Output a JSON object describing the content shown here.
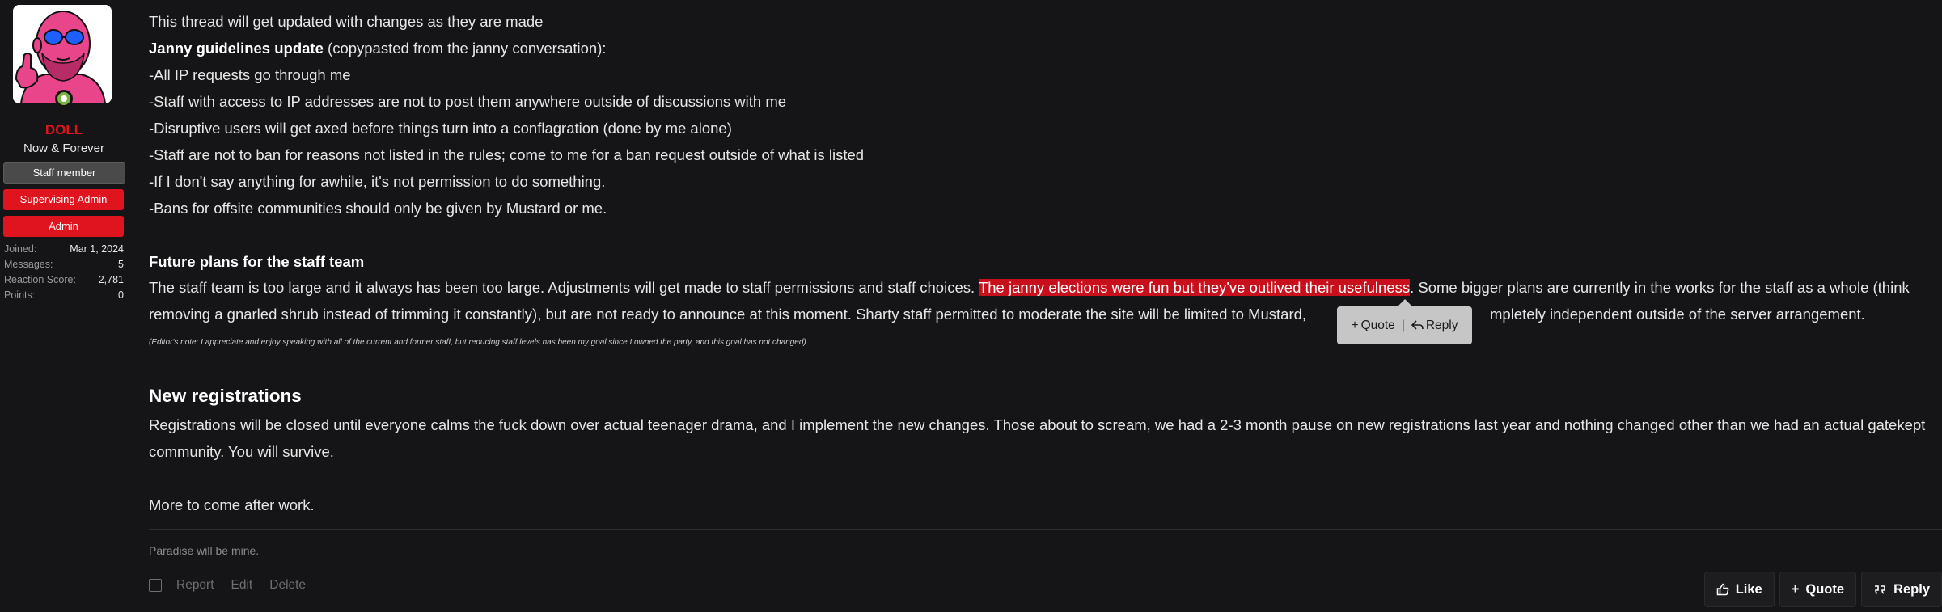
{
  "user": {
    "name": "DOLL",
    "title": "Now & Forever",
    "banners": [
      "Staff member",
      "Supervising Admin",
      "Admin"
    ],
    "stats": [
      {
        "label": "Joined:",
        "value": "Mar 1, 2024"
      },
      {
        "label": "Messages:",
        "value": "5"
      },
      {
        "label": "Reaction Score:",
        "value": "2,781"
      },
      {
        "label": "Points:",
        "value": "0"
      }
    ]
  },
  "post": {
    "intro": "This thread will get updated with changes as they are made",
    "janny_heading": "Janny guidelines update",
    "janny_heading_suffix": " (copypasted from the janny conversation):",
    "janny_rules": [
      "-All IP requests go through me",
      "-Staff with access to IP addresses are not to post them anywhere outside of discussions with me",
      "-Disruptive users will get axed before things turn into a conflagration (done by me alone)",
      "-Staff are not to ban for reasons not listed in the rules; come to me for a ban request outside of what is listed",
      "-If I don't say anything for awhile, it's not permission to do something.",
      "-Bans for offsite communities should only be given by Mustard or me."
    ],
    "future_heading": "Future plans for the staff team",
    "future_p1_a": "The staff team is too large and it always has been too large. Adjustments will get made to staff permissions and staff choices. ",
    "future_p1_highlight": "The janny elections were fun but they've outlived their usefulness",
    "future_p1_b": ". Some bigger plans are currently in the works for the staff as a whole (think",
    "future_p2_a": "removing a gnarled shrub instead of trimming it constantly), but are not ready to announce at this moment. Sharty staff permitted to moderate the site will be limited to Mustard,",
    "future_p2_b": "mpletely independent outside of the server arrangement.",
    "editor_note": "(Editor's note: I appreciate and enjoy speaking with all of the current and former staff, but reducing staff levels has been my goal since I owned the party, and this goal has not changed)",
    "reg_heading": "New registrations",
    "reg_p1": "Registrations will be closed until everyone calms the fuck down over actual teenager drama, and I implement the new changes. Those about to scream, we had a 2-3 month pause on new registrations last year and nothing changed other than we had an actual gatekept",
    "reg_p2": "community. You will survive.",
    "more": "More to come after work.",
    "signature": "Paradise will be mine."
  },
  "selection_popup": {
    "quote_label": "Quote",
    "separator": "|",
    "reply_label": "Reply"
  },
  "footer": {
    "left_actions": [
      "Report",
      "Edit",
      "Delete"
    ],
    "like_label": "Like",
    "quote_label": "Quote",
    "reply_label": "Reply"
  },
  "colors": {
    "accent_red": "#e0141e",
    "background": "#151416",
    "highlight": "#c8101c"
  }
}
